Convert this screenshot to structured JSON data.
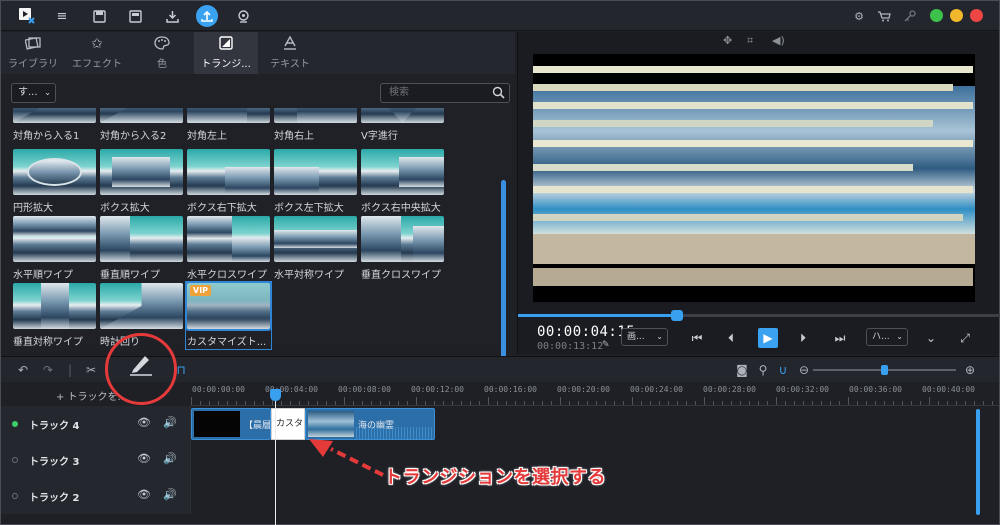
{
  "colors": {
    "accent": "#39a0ef",
    "annotation": "#e53a3a",
    "vip": "#f0a23a",
    "track_active": "#3ecf6a"
  },
  "titlebar": {
    "icons": [
      "logo-icon",
      "menu-icon",
      "save-icon",
      "save-as-icon",
      "import-icon",
      "export-icon",
      "webcam-icon"
    ],
    "right_icons": [
      "settings-icon",
      "cart-icon",
      "key-icon"
    ]
  },
  "library": {
    "tabs": [
      {
        "label": "ライブラリ",
        "icon": "library-icon"
      },
      {
        "label": "エフェクト",
        "icon": "effects-icon"
      },
      {
        "label": "色",
        "icon": "palette-icon"
      },
      {
        "label": "トランジ...",
        "icon": "transition-icon",
        "active": true
      },
      {
        "label": "テキスト",
        "icon": "text-icon"
      }
    ],
    "filter_value": "す...",
    "search_placeholder": "検索",
    "items": [
      {
        "label": "対角から入る1"
      },
      {
        "label": "対角から入る2"
      },
      {
        "label": "対角左上"
      },
      {
        "label": "対角右上"
      },
      {
        "label": "V字進行"
      },
      {
        "label": "円形拡大"
      },
      {
        "label": "ボクス拡大"
      },
      {
        "label": "ボクス右下拡大"
      },
      {
        "label": "ボクス左下拡大"
      },
      {
        "label": "ボクス右中央拡大"
      },
      {
        "label": "水平順ワイプ"
      },
      {
        "label": "垂直順ワイプ"
      },
      {
        "label": "水平クロスワイプ"
      },
      {
        "label": "水平対称ワイプ"
      },
      {
        "label": "垂直クロスワイプ"
      },
      {
        "label": "垂直対称ワイプ"
      },
      {
        "label": "時計回り"
      },
      {
        "label": "カスタマイズト...",
        "vip": "VIP",
        "selected": true
      }
    ]
  },
  "preview": {
    "timecode": "00:00:04:15",
    "duration": "00:00:13:12",
    "quality_select": "画...",
    "speed_select": "ハ...",
    "progress": 0.33
  },
  "timeline": {
    "add_track_label": "+ トラックを...",
    "ruler": [
      "00:00:00:00",
      "00:00:04:00",
      "00:00:08:00",
      "00:00:12:00",
      "00:00:16:00",
      "00:00:20:00",
      "00:00:24:00",
      "00:00:28:00",
      "00:00:32:00",
      "00:00:36:00",
      "00:00:40:00"
    ],
    "tracks": [
      {
        "name": "トラック 4",
        "active": true
      },
      {
        "name": "トラック 3",
        "active": false
      },
      {
        "name": "トラック 2",
        "active": false
      }
    ],
    "clips": {
      "clip1_label": "【晨層",
      "transition_label": "カスタ",
      "clip2_label": "海の幽霊"
    }
  },
  "annotation": {
    "note": "トランジションを選択する"
  }
}
